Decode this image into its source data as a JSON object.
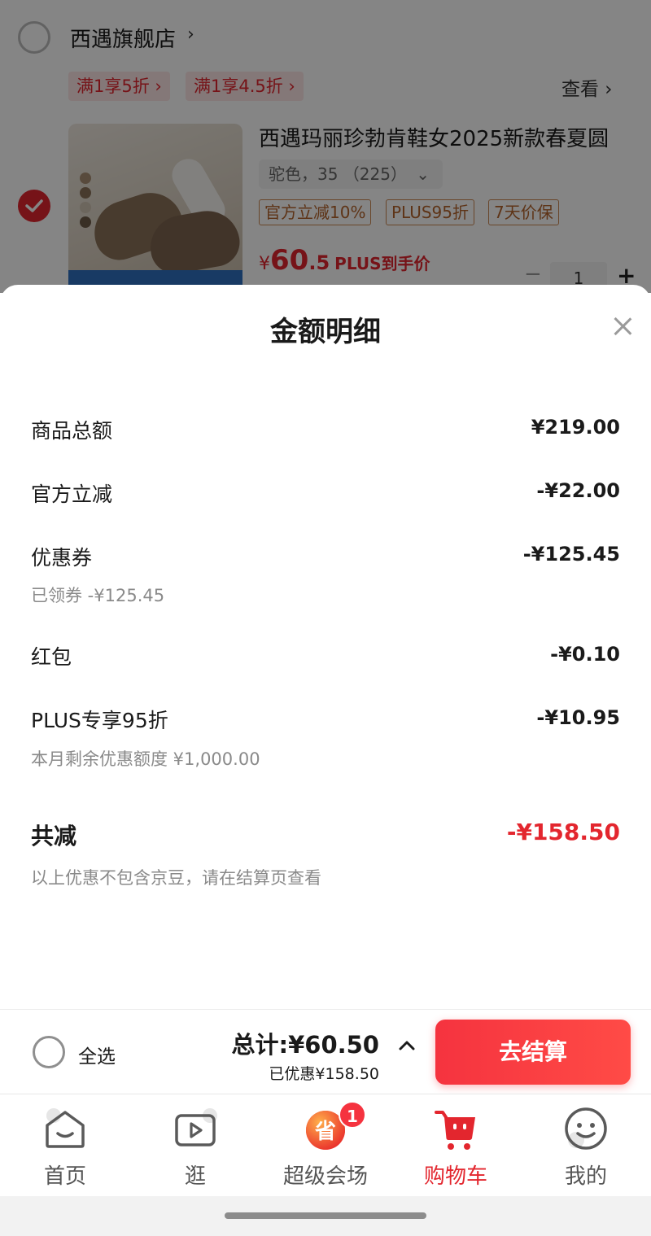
{
  "store": {
    "name": "西遇旗舰店",
    "promos": [
      "满1享5折 ›",
      "满1享4.5折 ›"
    ],
    "view_more": "查看 ›"
  },
  "product": {
    "title": "西遇玛丽珍勃肯鞋女2025新款春夏圆",
    "variant": "驼色，35 （225）",
    "tags": [
      "官方立减10%",
      "PLUS95折",
      "7天价保"
    ],
    "price_symbol": "¥",
    "price_int": "60",
    "price_dec": ".5",
    "price_label": "PLUS到手价",
    "quantity": "1",
    "checked": true
  },
  "sheet": {
    "title": "金额明细",
    "rows": [
      {
        "label": "商品总额",
        "value": "¥219.00"
      },
      {
        "label": "官方立减",
        "value": "-¥22.00"
      },
      {
        "label": "优惠券",
        "value": "-¥125.45",
        "sub": "已领券 -¥125.45"
      },
      {
        "label": "红包",
        "value": "-¥0.10"
      },
      {
        "label": "PLUS专享95折",
        "value": "-¥10.95",
        "sub": "本月剩余优惠额度 ¥1,000.00"
      }
    ],
    "total_label": "共减",
    "total_value": "-¥158.50",
    "note": "以上优惠不包含京豆，请在结算页查看"
  },
  "checkout": {
    "select_all": "全选",
    "total": "总计:¥60.50",
    "saved": "已优惠¥158.50",
    "button": "去结算"
  },
  "tabs": [
    {
      "label": "首页",
      "icon": "home-icon"
    },
    {
      "label": "逛",
      "icon": "video-icon"
    },
    {
      "label": "超级会场",
      "icon": "super-venue-icon",
      "badge": "1"
    },
    {
      "label": "购物车",
      "icon": "cart-icon",
      "active": true
    },
    {
      "label": "我的",
      "icon": "profile-icon"
    }
  ],
  "colors": {
    "accent": "#e3262e",
    "tag_border": "#c98652",
    "muted": "#8a8a8a"
  }
}
